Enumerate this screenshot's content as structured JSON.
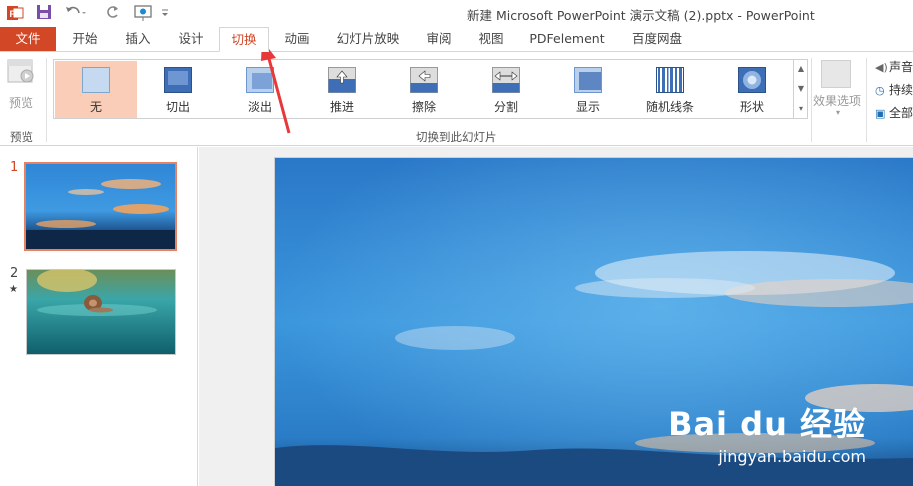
{
  "window": {
    "title": "新建 Microsoft PowerPoint 演示文稿 (2).pptx - PowerPoint"
  },
  "qat": {
    "icons": [
      "powerpoint-logo-icon",
      "save-icon",
      "undo-icon",
      "redo-icon",
      "start-from-beginning-icon",
      "customize-qat-icon"
    ]
  },
  "tabs": {
    "file": "文件",
    "home": "开始",
    "insert": "插入",
    "design": "设计",
    "transitions": "切换",
    "animations": "动画",
    "slideshow": "幻灯片放映",
    "review": "审阅",
    "view": "视图",
    "pdfelement": "PDFelement",
    "baidu": "百度网盘"
  },
  "ribbon": {
    "preview_button": "预览",
    "preview_group": "预览",
    "transitions_group": "切换到此幻灯片",
    "effect_options": "效果选项",
    "timing": {
      "sound": "声音",
      "duration": "持续",
      "apply_all": "全部"
    },
    "transitions": [
      {
        "label": "无"
      },
      {
        "label": "切出"
      },
      {
        "label": "淡出"
      },
      {
        "label": "推进"
      },
      {
        "label": "擦除"
      },
      {
        "label": "分割"
      },
      {
        "label": "显示"
      },
      {
        "label": "随机线条"
      },
      {
        "label": "形状"
      }
    ]
  },
  "slides": [
    {
      "number": "1",
      "marker": ""
    },
    {
      "number": "2",
      "marker": "★"
    }
  ],
  "watermark": {
    "logo": "Bai du 经验",
    "url": "jingyan.baidu.com"
  },
  "colors": {
    "accent": "#d24726",
    "selected_transition": "#f9cdb7",
    "annotation_arrow": "#e8393a"
  }
}
